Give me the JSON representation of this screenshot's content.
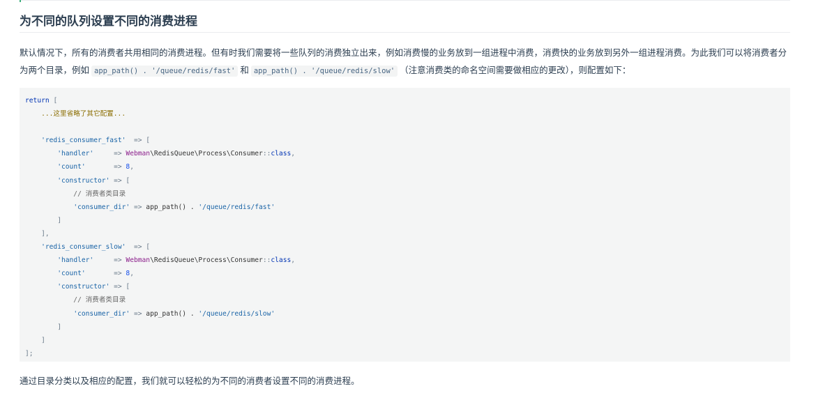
{
  "section": {
    "title": "为不同的队列设置不同的消费进程"
  },
  "intro": {
    "text_before": "默认情况下，所有的消费者共用相同的消费进程。但有时我们需要将一些队列的消费独立出来，例如消费慢的业务放到一组进程中消费，消费快的业务放到另外一组进程消费。为此我们可以将消费者分为两个目录，例如",
    "code_fast": "app_path() . '/queue/redis/fast'",
    "text_and": "和",
    "code_slow": "app_path() . '/queue/redis/slow'",
    "text_after": "（注意消费类的命名空间需要做相应的更改），则配置如下："
  },
  "code": {
    "lines": [
      [
        {
          "t": "return ",
          "c": "kw"
        },
        {
          "t": "[",
          "c": "op"
        }
      ],
      [
        {
          "t": "    ...这里省略了其它配置...",
          "c": "cm2"
        }
      ],
      [
        {
          "t": "",
          "c": ""
        }
      ],
      [
        {
          "t": "    ",
          "c": ""
        },
        {
          "t": "'redis_consumer_fast'",
          "c": "str2"
        },
        {
          "t": "  => [",
          "c": "op"
        }
      ],
      [
        {
          "t": "        ",
          "c": ""
        },
        {
          "t": "'handler'",
          "c": "str2"
        },
        {
          "t": "     => ",
          "c": "op"
        },
        {
          "t": "Webman",
          "c": "ns"
        },
        {
          "t": "\\RedisQueue\\Process\\Consumer",
          "c": ""
        },
        {
          "t": "::",
          "c": "op"
        },
        {
          "t": "class",
          "c": "cn"
        },
        {
          "t": ",",
          "c": "op"
        }
      ],
      [
        {
          "t": "        ",
          "c": ""
        },
        {
          "t": "'count'",
          "c": "str2"
        },
        {
          "t": "       => ",
          "c": "op"
        },
        {
          "t": "8",
          "c": "num"
        },
        {
          "t": ",",
          "c": "op"
        }
      ],
      [
        {
          "t": "        ",
          "c": ""
        },
        {
          "t": "'constructor'",
          "c": "str2"
        },
        {
          "t": " => [",
          "c": "op"
        }
      ],
      [
        {
          "t": "            // 消费者类目录",
          "c": "cm"
        }
      ],
      [
        {
          "t": "            ",
          "c": ""
        },
        {
          "t": "'consumer_dir'",
          "c": "str2"
        },
        {
          "t": " => ",
          "c": "op"
        },
        {
          "t": "app_path() . ",
          "c": ""
        },
        {
          "t": "'/queue/redis/fast'",
          "c": "str2"
        }
      ],
      [
        {
          "t": "        ]",
          "c": "op"
        }
      ],
      [
        {
          "t": "    ],",
          "c": "op"
        }
      ],
      [
        {
          "t": "    ",
          "c": ""
        },
        {
          "t": "'redis_consumer_slow'",
          "c": "str2"
        },
        {
          "t": "  => [",
          "c": "op"
        }
      ],
      [
        {
          "t": "        ",
          "c": ""
        },
        {
          "t": "'handler'",
          "c": "str2"
        },
        {
          "t": "     => ",
          "c": "op"
        },
        {
          "t": "Webman",
          "c": "ns"
        },
        {
          "t": "\\RedisQueue\\Process\\Consumer",
          "c": ""
        },
        {
          "t": "::",
          "c": "op"
        },
        {
          "t": "class",
          "c": "cn"
        },
        {
          "t": ",",
          "c": "op"
        }
      ],
      [
        {
          "t": "        ",
          "c": ""
        },
        {
          "t": "'count'",
          "c": "str2"
        },
        {
          "t": "       => ",
          "c": "op"
        },
        {
          "t": "8",
          "c": "num"
        },
        {
          "t": ",",
          "c": "op"
        }
      ],
      [
        {
          "t": "        ",
          "c": ""
        },
        {
          "t": "'constructor'",
          "c": "str2"
        },
        {
          "t": " => [",
          "c": "op"
        }
      ],
      [
        {
          "t": "            // 消费者类目录",
          "c": "cm"
        }
      ],
      [
        {
          "t": "            ",
          "c": ""
        },
        {
          "t": "'consumer_dir'",
          "c": "str2"
        },
        {
          "t": " => ",
          "c": "op"
        },
        {
          "t": "app_path() . ",
          "c": ""
        },
        {
          "t": "'/queue/redis/slow'",
          "c": "str2"
        }
      ],
      [
        {
          "t": "        ]",
          "c": "op"
        }
      ],
      [
        {
          "t": "    ]",
          "c": "op"
        }
      ],
      [
        {
          "t": "];",
          "c": "op"
        }
      ]
    ]
  },
  "outro": {
    "text": "通过目录分类以及相应的配置，我们就可以轻松的为不同的消费者设置不同的消费进程。"
  },
  "colors": {
    "accent": "#3eaf7c",
    "code_background": "#f4f5f5",
    "text": "#2c3e50"
  }
}
